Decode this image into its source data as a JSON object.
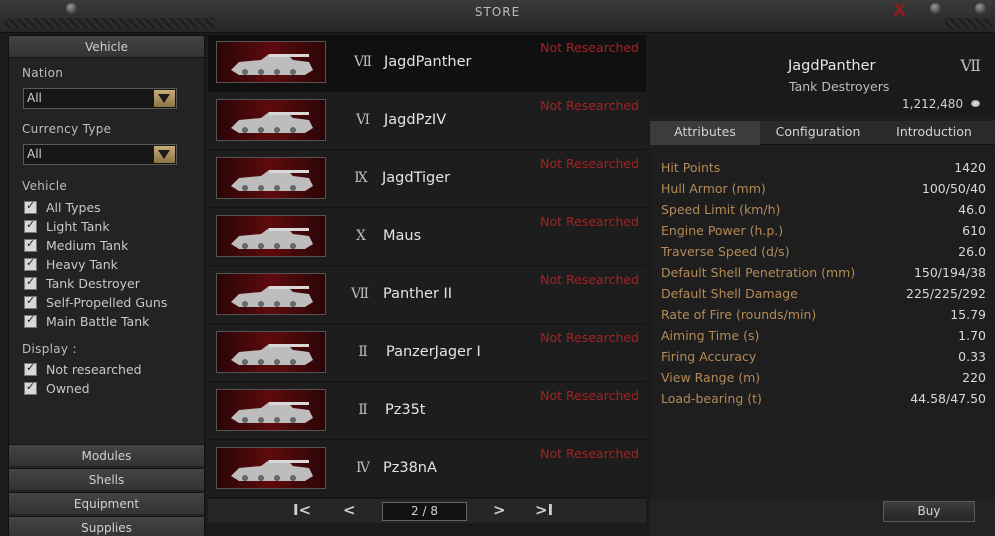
{
  "window": {
    "title": "STORE",
    "close_label": "X"
  },
  "filters": {
    "header": "Vehicle",
    "nation_label": "Nation",
    "nation_value": "All",
    "currency_label": "Currency Type",
    "currency_value": "All",
    "vehicle_label": "Vehicle",
    "vehicle_types": [
      "All Types",
      "Light Tank",
      "Medium Tank",
      "Heavy Tank",
      "Tank Destroyer",
      "Self-Propelled Guns",
      "Main Battle Tank"
    ],
    "display_label": "Display :",
    "display_options": [
      "Not researched",
      "Owned"
    ]
  },
  "bottom_menu": [
    "Modules",
    "Shells",
    "Equipment",
    "Supplies"
  ],
  "tanks": [
    {
      "tier": "Ⅶ",
      "name": "JagdPanther",
      "status": "Not Researched"
    },
    {
      "tier": "Ⅵ",
      "name": "JagdPzIV",
      "status": "Not Researched"
    },
    {
      "tier": "Ⅸ",
      "name": "JagdTiger",
      "status": "Not Researched"
    },
    {
      "tier": "Ⅹ",
      "name": "Maus",
      "status": "Not Researched"
    },
    {
      "tier": "Ⅶ",
      "name": "Panther II",
      "status": "Not Researched"
    },
    {
      "tier": "Ⅱ",
      "name": "PanzerJager I",
      "status": "Not Researched"
    },
    {
      "tier": "Ⅱ",
      "name": "Pz35t",
      "status": "Not Researched"
    },
    {
      "tier": "Ⅳ",
      "name": "Pz38nA",
      "status": "Not Researched"
    }
  ],
  "pager": {
    "first": "I<",
    "prev": "<",
    "page": "2 / 8",
    "next": ">",
    "last": ">I"
  },
  "detail": {
    "name": "JagdPanther",
    "tier": "Ⅶ",
    "class": "Tank Destroyers",
    "price": "1,212,480",
    "tabs": [
      "Attributes",
      "Configuration",
      "Introduction"
    ],
    "attributes": [
      {
        "key": "Hit Points",
        "value": "1420"
      },
      {
        "key": "Hull Armor (mm)",
        "value": "100/50/40"
      },
      {
        "key": "Speed Limit (km/h)",
        "value": "46.0"
      },
      {
        "key": "Engine Power (h.p.)",
        "value": "610"
      },
      {
        "key": "Traverse Speed (d/s)",
        "value": "26.0"
      },
      {
        "key": "Default Shell Penetration (mm)",
        "value": "150/194/38"
      },
      {
        "key": "Default Shell Damage",
        "value": "225/225/292"
      },
      {
        "key": "Rate of Fire (rounds/min)",
        "value": "15.79"
      },
      {
        "key": "Aiming Time (s)",
        "value": "1.70"
      },
      {
        "key": "Firing Accuracy",
        "value": "0.33"
      },
      {
        "key": "View Range (m)",
        "value": "220"
      },
      {
        "key": "Load-bearing (t)",
        "value": "44.58/47.50"
      }
    ],
    "buy_label": "Buy"
  }
}
